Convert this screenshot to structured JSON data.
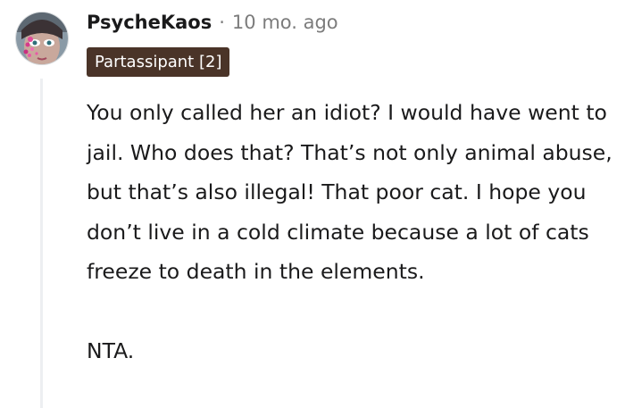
{
  "comment": {
    "username": "PsycheKaos",
    "separator": "·",
    "timestamp": "10 mo. ago",
    "flair": "Partassipant [2]",
    "paragraphs": [
      "You only called her an idiot? I would have went to jail. Who does that? That’s not only animal abuse, but that’s also illegal! That poor cat. I hope you don’t live in a cold climate because a lot of cats freeze to death in the elements.",
      "NTA."
    ]
  },
  "colors": {
    "flair_background": "#4a3428",
    "text": "#1a1a1b",
    "muted": "#7c7c7c",
    "thread_line": "#edeff1"
  },
  "icons": {
    "avatar": "user-avatar"
  }
}
